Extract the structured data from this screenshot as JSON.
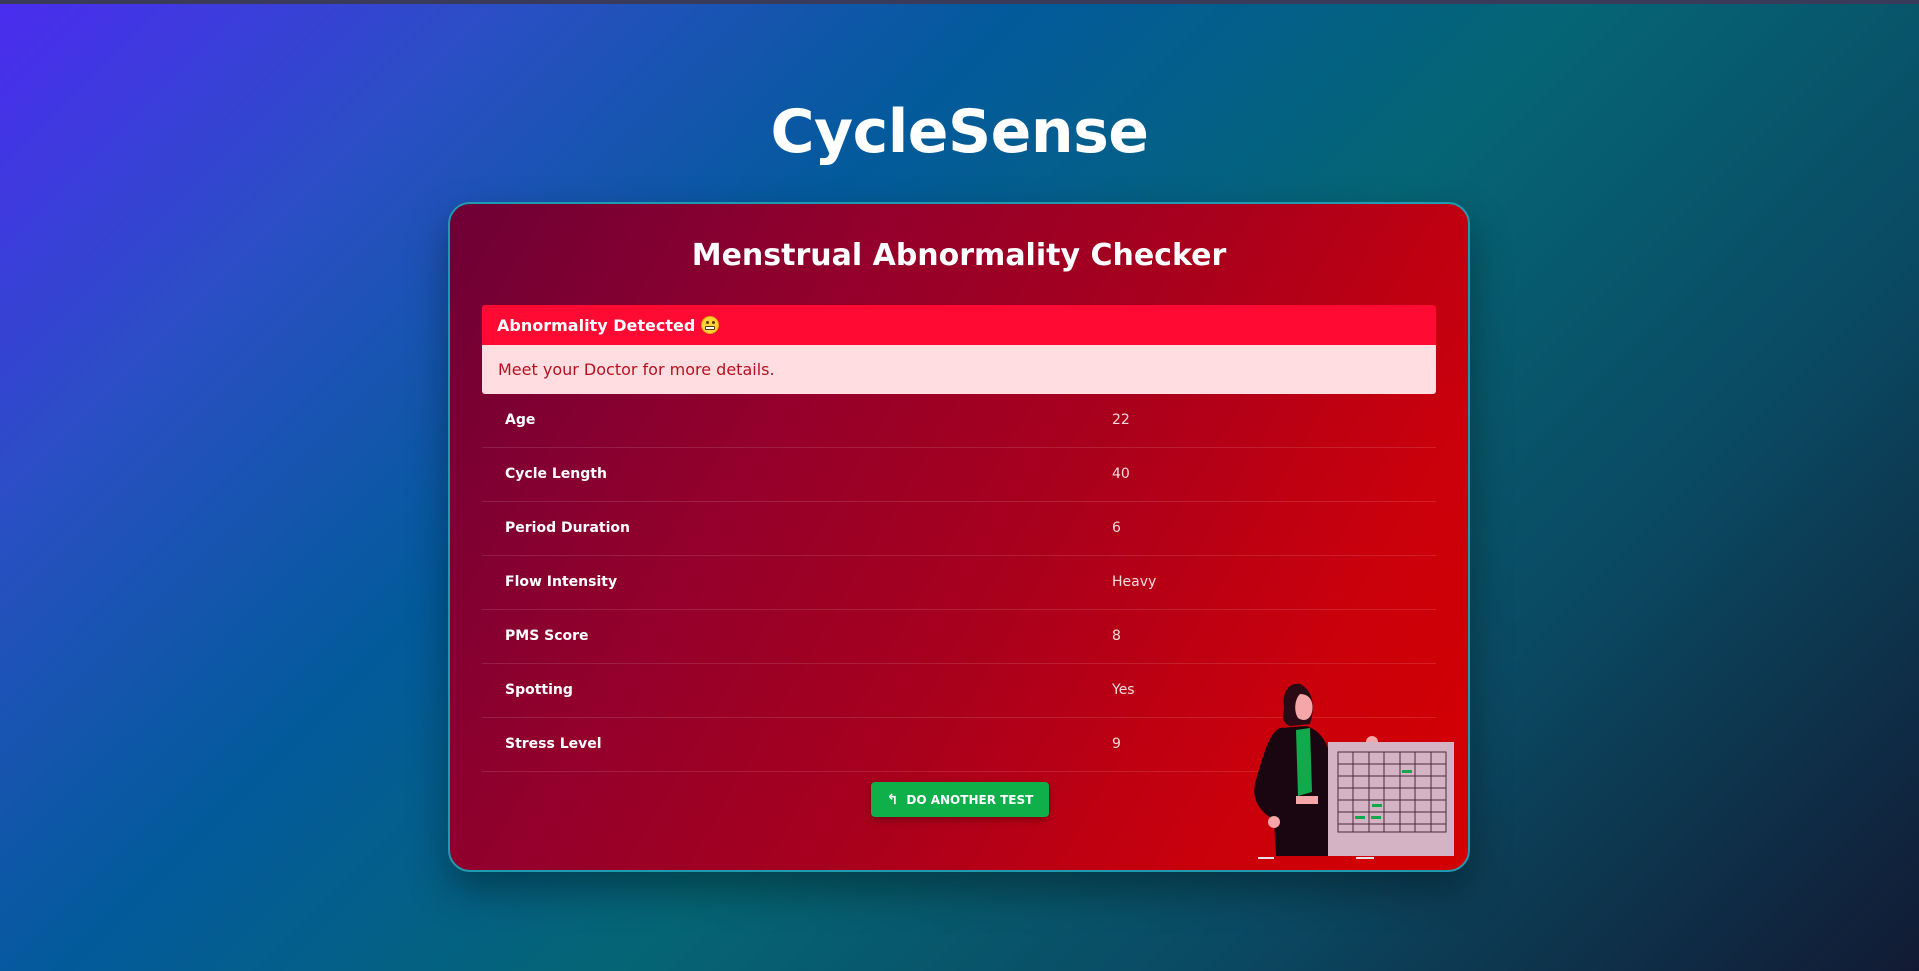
{
  "app": {
    "title": "CycleSense"
  },
  "card": {
    "title": "Menstrual Abnormality Checker"
  },
  "alert": {
    "heading": "Abnormality Detected",
    "message": "Meet your Doctor for more details.",
    "header_color": "#ff0a33",
    "body_color": "#ffdde0"
  },
  "details": [
    {
      "label": "Age",
      "value": "22"
    },
    {
      "label": "Cycle Length",
      "value": "40"
    },
    {
      "label": "Period Duration",
      "value": "6"
    },
    {
      "label": "Flow Intensity",
      "value": "Heavy"
    },
    {
      "label": "PMS Score",
      "value": "8"
    },
    {
      "label": "Spotting",
      "value": "Yes"
    },
    {
      "label": "Stress Level",
      "value": "9"
    }
  ],
  "actions": {
    "retry_label": "DO ANOTHER TEST",
    "retry_icon": "undo-arrow-icon",
    "retry_color": "#0fb04a"
  },
  "illustration": {
    "icon": "woman-with-calendar-illustration"
  }
}
